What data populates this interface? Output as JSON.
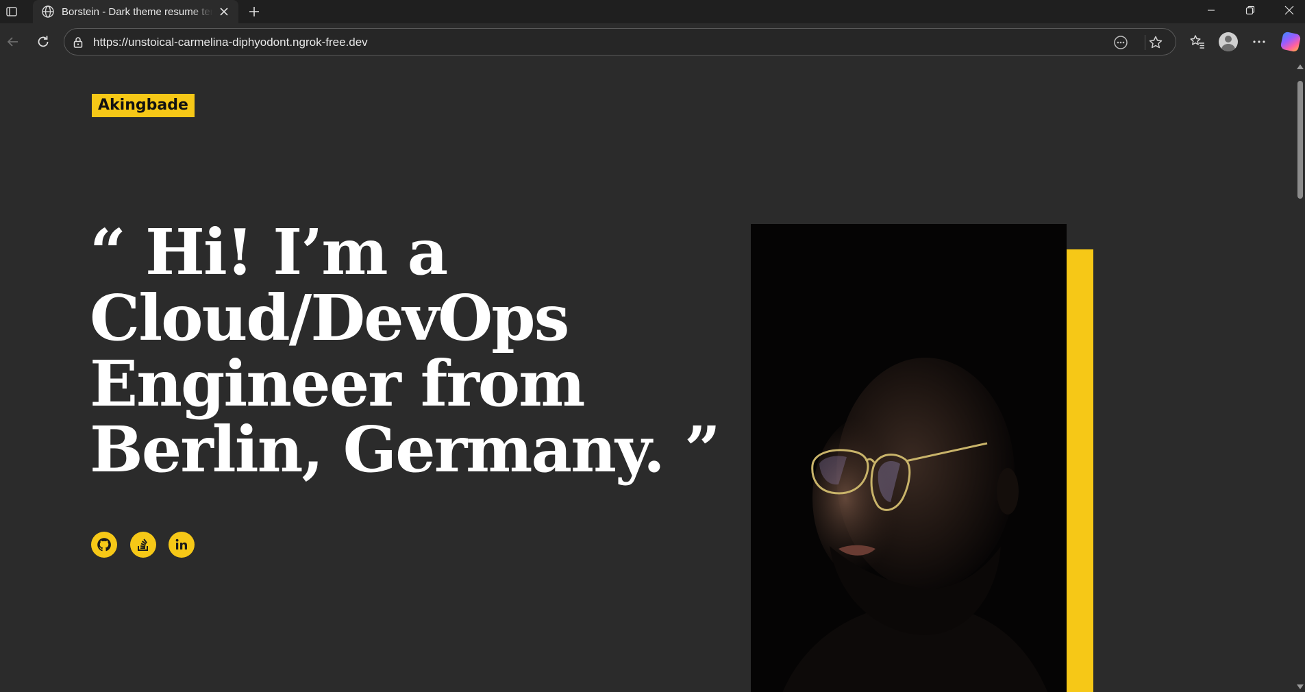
{
  "browser": {
    "tab": {
      "title": "Borstein - Dark theme resume template"
    },
    "url": "https://unstoical-carmelina-diphyodont.ngrok-free.dev",
    "icons": {
      "tab_actions": "tab-actions-icon",
      "tab_favicon": "globe-icon",
      "tab_close": "close-icon",
      "new_tab": "plus-icon",
      "minimize": "minimize-icon",
      "restore": "restore-icon",
      "close_window": "close-icon",
      "back": "back-arrow-icon",
      "refresh": "refresh-icon",
      "site_info": "lock-icon",
      "read_aloud": "more-circle-icon",
      "favorite": "star-icon",
      "favorites": "favorites-icon",
      "profile": "profile-icon",
      "settings": "ellipsis-icon",
      "copilot": "copilot-icon"
    }
  },
  "page": {
    "logo": "Akingbade",
    "headline": {
      "line1": "“ Hi! I’m a",
      "line2": "Cloud/DevOps",
      "line3": "Engineer from",
      "line4": "Berlin, Germany. ”"
    },
    "social": [
      {
        "name": "github-icon"
      },
      {
        "name": "stackoverflow-icon"
      },
      {
        "name": "linkedin-icon"
      }
    ],
    "portrait": {
      "name": "portrait-photo"
    },
    "colors": {
      "background": "#2b2b2b",
      "accent": "#f6c817",
      "text": "#ffffff"
    }
  }
}
